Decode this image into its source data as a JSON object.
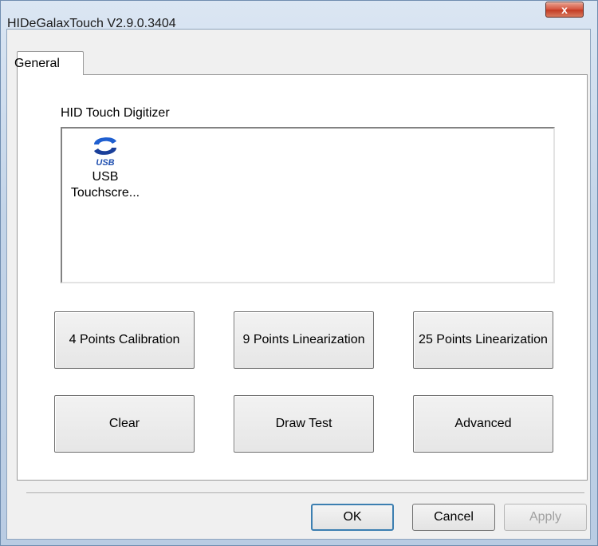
{
  "window": {
    "title": "HIDeGalaxTouch V2.9.0.3404",
    "close_label": "x"
  },
  "tabs": [
    {
      "label": "General",
      "selected": true
    }
  ],
  "general": {
    "group_label": "HID Touch Digitizer",
    "devices": [
      {
        "icon": "usb-icon",
        "icon_text": "USB",
        "label_line1": "USB",
        "label_line2": "Touchscre..."
      }
    ],
    "buttons": {
      "calibration_4": "4 Points Calibration",
      "linearization_9": "9 Points Linearization",
      "linearization_25": "25 Points Linearization",
      "clear": "Clear",
      "draw_test": "Draw Test",
      "advanced": "Advanced"
    }
  },
  "footer": {
    "ok": "OK",
    "cancel": "Cancel",
    "apply": "Apply",
    "apply_enabled": false
  },
  "colors": {
    "accent_blue": "#2f5fbf",
    "close_red": "#c23a22"
  }
}
